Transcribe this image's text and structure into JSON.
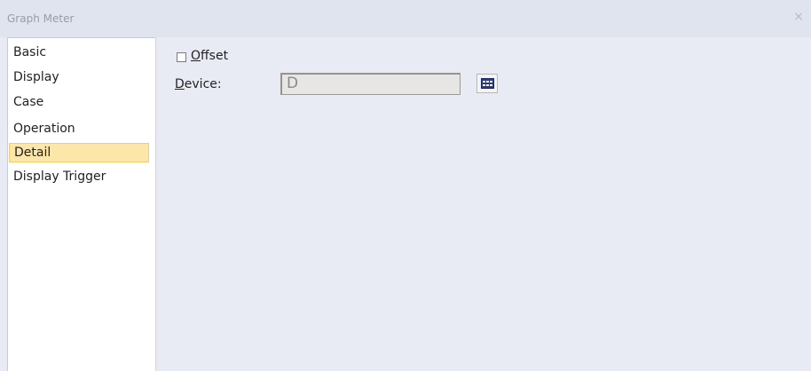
{
  "window": {
    "title": "Graph Meter",
    "close_glyph": "×"
  },
  "sidebar": {
    "items": [
      {
        "label": "Basic"
      },
      {
        "label": "Display"
      },
      {
        "label": "Case"
      },
      {
        "label": "Operation"
      },
      {
        "label": "Detail",
        "selected": true
      },
      {
        "label": "Display Trigger"
      }
    ]
  },
  "detail": {
    "offset": {
      "label_underlined": "O",
      "label_rest": "ffset",
      "checked": false
    },
    "device": {
      "label_underlined": "D",
      "label_rest": "evice:",
      "value": "D",
      "browse_icon": "device-list-icon"
    }
  },
  "colors": {
    "selected_bg": "#fde7a8",
    "selected_border": "#f2cd72",
    "panel_bg": "#e8ebf3"
  }
}
